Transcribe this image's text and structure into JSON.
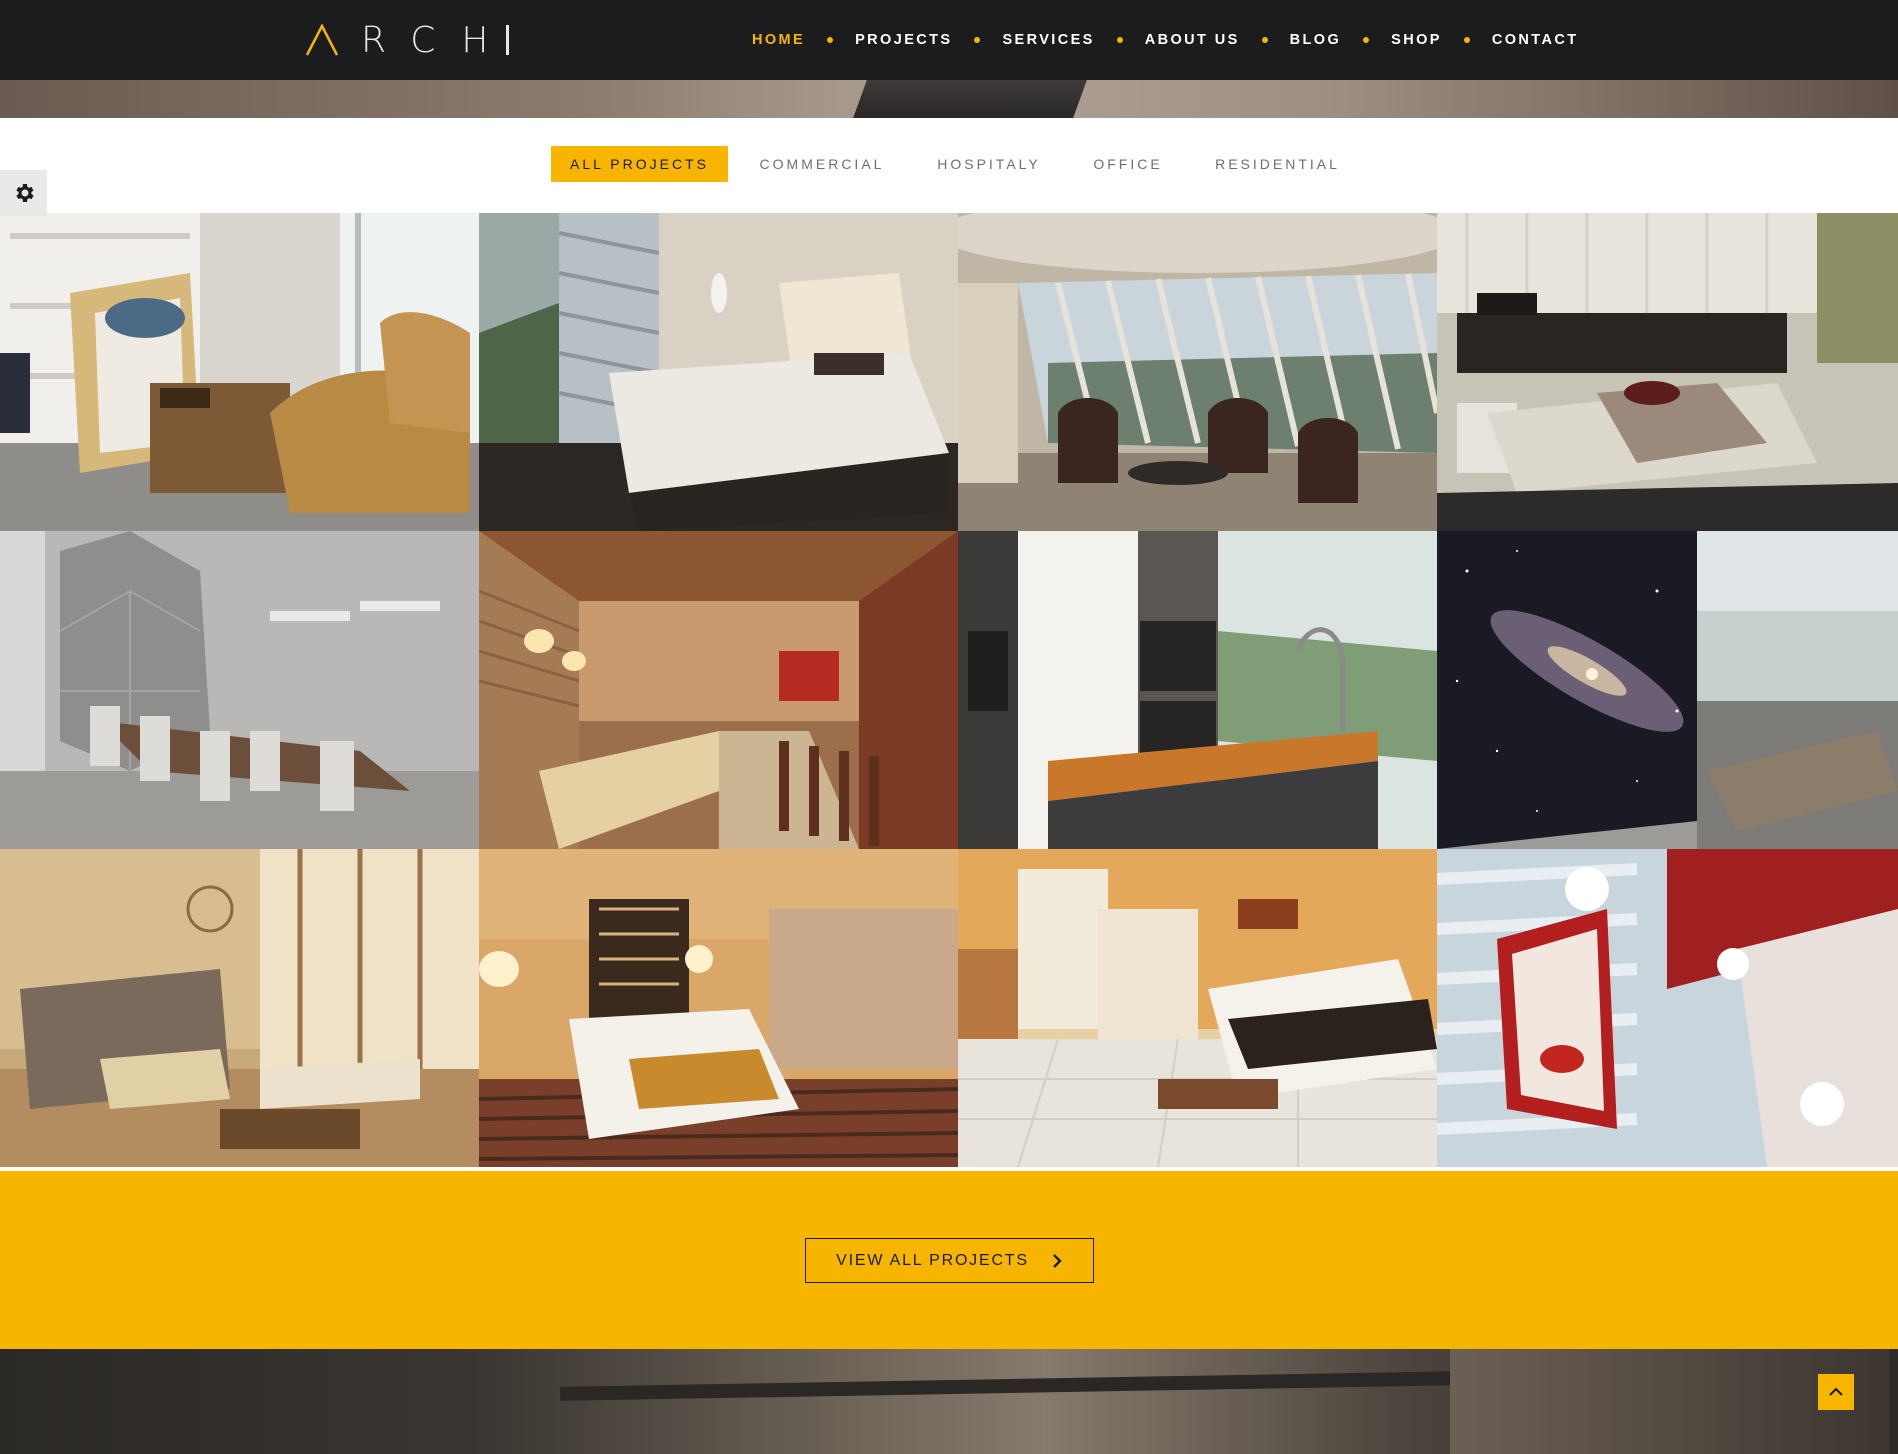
{
  "header": {
    "logo_text": "RCH",
    "nav": [
      {
        "label": "HOME",
        "active": true
      },
      {
        "label": "PROJECTS",
        "active": false
      },
      {
        "label": "SERVICES",
        "active": false
      },
      {
        "label": "ABOUT US",
        "active": false
      },
      {
        "label": "BLOG",
        "active": false
      },
      {
        "label": "SHOP",
        "active": false
      },
      {
        "label": "CONTACT",
        "active": false
      }
    ]
  },
  "filters": [
    {
      "label": "ALL PROJECTS",
      "active": true
    },
    {
      "label": "COMMERCIAL",
      "active": false
    },
    {
      "label": "HOSPITALY",
      "active": false
    },
    {
      "label": "OFFICE",
      "active": false
    },
    {
      "label": "RESIDENTIAL",
      "active": false
    }
  ],
  "cta": {
    "label": "VIEW ALL PROJECTS"
  },
  "colors": {
    "accent": "#f7b500",
    "dark": "#1b1c1e",
    "filter_text": "#6f6f6f"
  },
  "icons": {
    "settings": "gear-icon",
    "cta_arrow": "chevron-right-icon",
    "back_to_top": "chevron-up-icon"
  }
}
